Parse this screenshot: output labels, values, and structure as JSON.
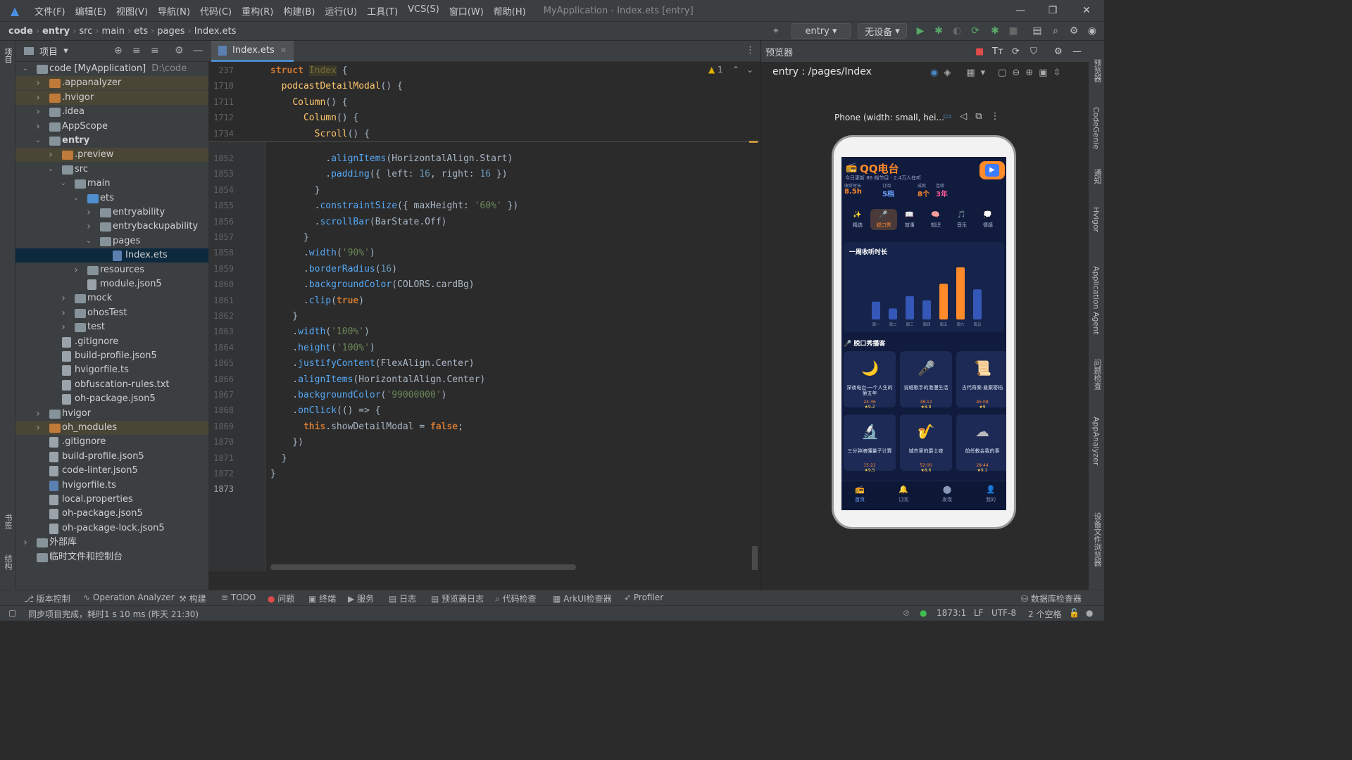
{
  "menubar": {
    "items": [
      "文件(F)",
      "编辑(E)",
      "视图(V)",
      "导航(N)",
      "代码(C)",
      "重构(R)",
      "构建(B)",
      "运行(U)",
      "工具(T)",
      "VCS(S)",
      "窗口(W)",
      "帮助(H)"
    ],
    "window_title": "MyApplication - Index.ets [entry]"
  },
  "breadcrumb": [
    "code",
    "entry",
    "src",
    "main",
    "ets",
    "pages",
    "Index.ets"
  ],
  "toolbar": {
    "module": "entry",
    "device": "无设备"
  },
  "project": {
    "header": "项目",
    "tree": [
      {
        "label": "code [MyApplication]",
        "sub": "D:\\code",
        "depth": 0,
        "arrow": "open",
        "icon": "folder"
      },
      {
        "label": ".appanalyzer",
        "depth": 1,
        "arrow": "closed",
        "icon": "ofolder",
        "hl": "orange"
      },
      {
        "label": ".hvigor",
        "depth": 1,
        "arrow": "closed",
        "icon": "ofolder",
        "hl": "orange"
      },
      {
        "label": ".idea",
        "depth": 1,
        "arrow": "closed",
        "icon": "folder"
      },
      {
        "label": "AppScope",
        "depth": 1,
        "arrow": "closed",
        "icon": "folder"
      },
      {
        "label": "entry",
        "depth": 1,
        "arrow": "open",
        "icon": "folder",
        "bold": true
      },
      {
        "label": ".preview",
        "depth": 2,
        "arrow": "closed",
        "icon": "ofolder",
        "hl": "orange"
      },
      {
        "label": "src",
        "depth": 2,
        "arrow": "open",
        "icon": "folder"
      },
      {
        "label": "main",
        "depth": 3,
        "arrow": "open",
        "icon": "folder"
      },
      {
        "label": "ets",
        "depth": 4,
        "arrow": "open",
        "icon": "bfolder"
      },
      {
        "label": "entryability",
        "depth": 5,
        "arrow": "closed",
        "icon": "folder"
      },
      {
        "label": "entrybackupability",
        "depth": 5,
        "arrow": "closed",
        "icon": "folder"
      },
      {
        "label": "pages",
        "depth": 5,
        "arrow": "open",
        "icon": "folder"
      },
      {
        "label": "Index.ets",
        "depth": 6,
        "arrow": "",
        "icon": "efile",
        "hl": "sel"
      },
      {
        "label": "resources",
        "depth": 4,
        "arrow": "closed",
        "icon": "folder"
      },
      {
        "label": "module.json5",
        "depth": 4,
        "arrow": "",
        "icon": "file"
      },
      {
        "label": "mock",
        "depth": 3,
        "arrow": "closed",
        "icon": "folder"
      },
      {
        "label": "ohosTest",
        "depth": 3,
        "arrow": "closed",
        "icon": "folder"
      },
      {
        "label": "test",
        "depth": 3,
        "arrow": "closed",
        "icon": "folder"
      },
      {
        "label": ".gitignore",
        "depth": 2,
        "arrow": "",
        "icon": "file"
      },
      {
        "label": "build-profile.json5",
        "depth": 2,
        "arrow": "",
        "icon": "file"
      },
      {
        "label": "hvigorfile.ts",
        "depth": 2,
        "arrow": "",
        "icon": "file"
      },
      {
        "label": "obfuscation-rules.txt",
        "depth": 2,
        "arrow": "",
        "icon": "file"
      },
      {
        "label": "oh-package.json5",
        "depth": 2,
        "arrow": "",
        "icon": "file"
      },
      {
        "label": "hvigor",
        "depth": 1,
        "arrow": "closed",
        "icon": "folder"
      },
      {
        "label": "oh_modules",
        "depth": 1,
        "arrow": "closed",
        "icon": "ofolder",
        "hl": "orange"
      },
      {
        "label": ".gitignore",
        "depth": 1,
        "arrow": "",
        "icon": "file"
      },
      {
        "label": "build-profile.json5",
        "depth": 1,
        "arrow": "",
        "icon": "file"
      },
      {
        "label": "code-linter.json5",
        "depth": 1,
        "arrow": "",
        "icon": "file"
      },
      {
        "label": "hvigorfile.ts",
        "depth": 1,
        "arrow": "",
        "icon": "efile"
      },
      {
        "label": "local.properties",
        "depth": 1,
        "arrow": "",
        "icon": "file"
      },
      {
        "label": "oh-package.json5",
        "depth": 1,
        "arrow": "",
        "icon": "file"
      },
      {
        "label": "oh-package-lock.json5",
        "depth": 1,
        "arrow": "",
        "icon": "file"
      },
      {
        "label": "外部库",
        "depth": 0,
        "arrow": "closed",
        "icon": "folder"
      },
      {
        "label": "临时文件和控制台",
        "depth": 0,
        "arrow": "",
        "icon": "folder"
      }
    ]
  },
  "editor": {
    "tab": "Index.ets",
    "warning_count": "1",
    "sticky": [
      {
        "ln": "237",
        "html": "<span class='kw'>struct</span> <span style='background:#3b3a29;color:#7a6a3a'>Index</span> {"
      },
      {
        "ln": "1710",
        "html": "  <span class='fn'>podcastDetailModal</span>() {"
      },
      {
        "ln": "1711",
        "html": "    <span class='fn'>Column</span>() {"
      },
      {
        "ln": "1712",
        "html": "      <span class='fn'>Column</span>() {"
      },
      {
        "ln": "1734",
        "html": "        <span class='fn'>Scroll</span>() {"
      }
    ],
    "lines": [
      {
        "ln": "1852",
        "html": "          .<span class='mth'>alignItems</span>(HorizontalAlign.Start)"
      },
      {
        "ln": "1853",
        "html": "          .<span class='mth'>padding</span>({ left: <span class='num'>16</span>, right: <span class='num'>16</span> })"
      },
      {
        "ln": "1854",
        "html": "        }"
      },
      {
        "ln": "1855",
        "html": "        .<span class='mth'>constraintSize</span>({ maxHeight: <span class='str'>'60%'</span> })"
      },
      {
        "ln": "1856",
        "html": "        .<span class='mth'>scrollBar</span>(BarState.Off)"
      },
      {
        "ln": "1857",
        "html": "      }"
      },
      {
        "ln": "1858",
        "html": "      .<span class='mth'>width</span>(<span class='str'>'90%'</span>)"
      },
      {
        "ln": "1859",
        "html": "      .<span class='mth'>borderRadius</span>(<span class='num'>16</span>)"
      },
      {
        "ln": "1860",
        "html": "      .<span class='mth'>backgroundColor</span>(COLORS.cardBg)"
      },
      {
        "ln": "1861",
        "html": "      .<span class='mth'>clip</span>(<span class='kw'>true</span>)"
      },
      {
        "ln": "1862",
        "html": "    }"
      },
      {
        "ln": "1863",
        "html": "    .<span class='mth'>width</span>(<span class='str'>'100%'</span>)"
      },
      {
        "ln": "1864",
        "html": "    .<span class='mth'>height</span>(<span class='str'>'100%'</span>)"
      },
      {
        "ln": "1865",
        "html": "    .<span class='mth'>justifyContent</span>(FlexAlign.Center)"
      },
      {
        "ln": "1866",
        "html": "    .<span class='mth'>alignItems</span>(HorizontalAlign.Center)"
      },
      {
        "ln": "1867",
        "html": "    .<span class='mth'>backgroundColor</span>(<span class='str'>'99000000'</span>)"
      },
      {
        "ln": "1868",
        "html": "    .<span class='mth'>onClick</span>(() => {"
      },
      {
        "ln": "1869",
        "html": "      <span class='kw'>this</span>.showDetailModal = <span class='kw'>false</span>;"
      },
      {
        "ln": "1870",
        "html": "    })"
      },
      {
        "ln": "1871",
        "html": "  }"
      },
      {
        "ln": "1872",
        "html": "}"
      },
      {
        "ln": "1873",
        "html": ""
      }
    ]
  },
  "preview": {
    "header": "预览器",
    "route": "entry : /pages/Index",
    "device": "Phone (width: small, hei..."
  },
  "app": {
    "title": "QQ电台",
    "subtitle": "今日更新 86 档节目 · 2.4万人在听",
    "stats": [
      {
        "label": "收听时长",
        "value": "8.5h"
      },
      {
        "label": "订阅",
        "value": "5档"
      },
      {
        "label": "成就",
        "value": "8个"
      },
      {
        "label": "连续",
        "value": "3年"
      }
    ],
    "categories": [
      "精选",
      "脱口秀",
      "故事",
      "知识",
      "音乐",
      "情感"
    ],
    "week_title": "一周收听时长",
    "podcast_title": "脱口秀播客",
    "podcasts": [
      {
        "title": "深夜电台·一个人生的第五年",
        "dur": "24:36",
        "rating": "★9.2",
        "icon": "🌙"
      },
      {
        "title": "说唱歌手的港漫生活",
        "dur": "38:12",
        "rating": "★8.8",
        "icon": "🎤"
      },
      {
        "title": "古代奇案·悬案密档",
        "dur": "45:08",
        "rating": "★9",
        "icon": "📜"
      },
      {
        "title": "三分钟搞懂量子计算",
        "dur": "15:22",
        "rating": "★9.5",
        "icon": "🔬"
      },
      {
        "title": "城市里的爵士夜",
        "dur": "52:00",
        "rating": "★8.6",
        "icon": "🎷"
      },
      {
        "title": "前任教会我的事",
        "dur": "28:44",
        "rating": "★9.1",
        "icon": "☁"
      }
    ],
    "nav": [
      "首页",
      "订阅",
      "发现",
      "我的"
    ]
  },
  "chart_data": {
    "type": "bar",
    "title": "一周收听时长",
    "categories": [
      "周一",
      "周二",
      "周三",
      "周四",
      "周五",
      "周六",
      "周日"
    ],
    "values": [
      1.3,
      0.8,
      1.7,
      1.4,
      2.6,
      3.8,
      2.2
    ],
    "colors": [
      "#3557b7",
      "#3557b7",
      "#3557b7",
      "#3557b7",
      "#ff8a2a",
      "#ff8a2a",
      "#3557b7"
    ],
    "ylim": [
      0,
      4
    ]
  },
  "toolwindows": [
    "版本控制",
    "Operation Analyzer",
    "构建",
    "TODO",
    "问题",
    "终端",
    "服务",
    "日志",
    "预览器日志",
    "代码检查",
    "ArkUI检查器",
    "Profiler",
    "数据库检查器"
  ],
  "status": {
    "message": "同步项目完成，耗时1 s 10 ms (昨天 21:30)",
    "position": "1873:1",
    "line_sep": "LF",
    "encoding": "UTF-8",
    "indent": "2 个空格"
  },
  "strips": {
    "left": [
      "项目",
      "书签",
      "结构"
    ],
    "right": [
      "预览器",
      "CodeGenie",
      "通知",
      "Hvigor",
      "Application Agent",
      "问题检查",
      "AppAnalyzer",
      "设备文件浏览器"
    ]
  }
}
